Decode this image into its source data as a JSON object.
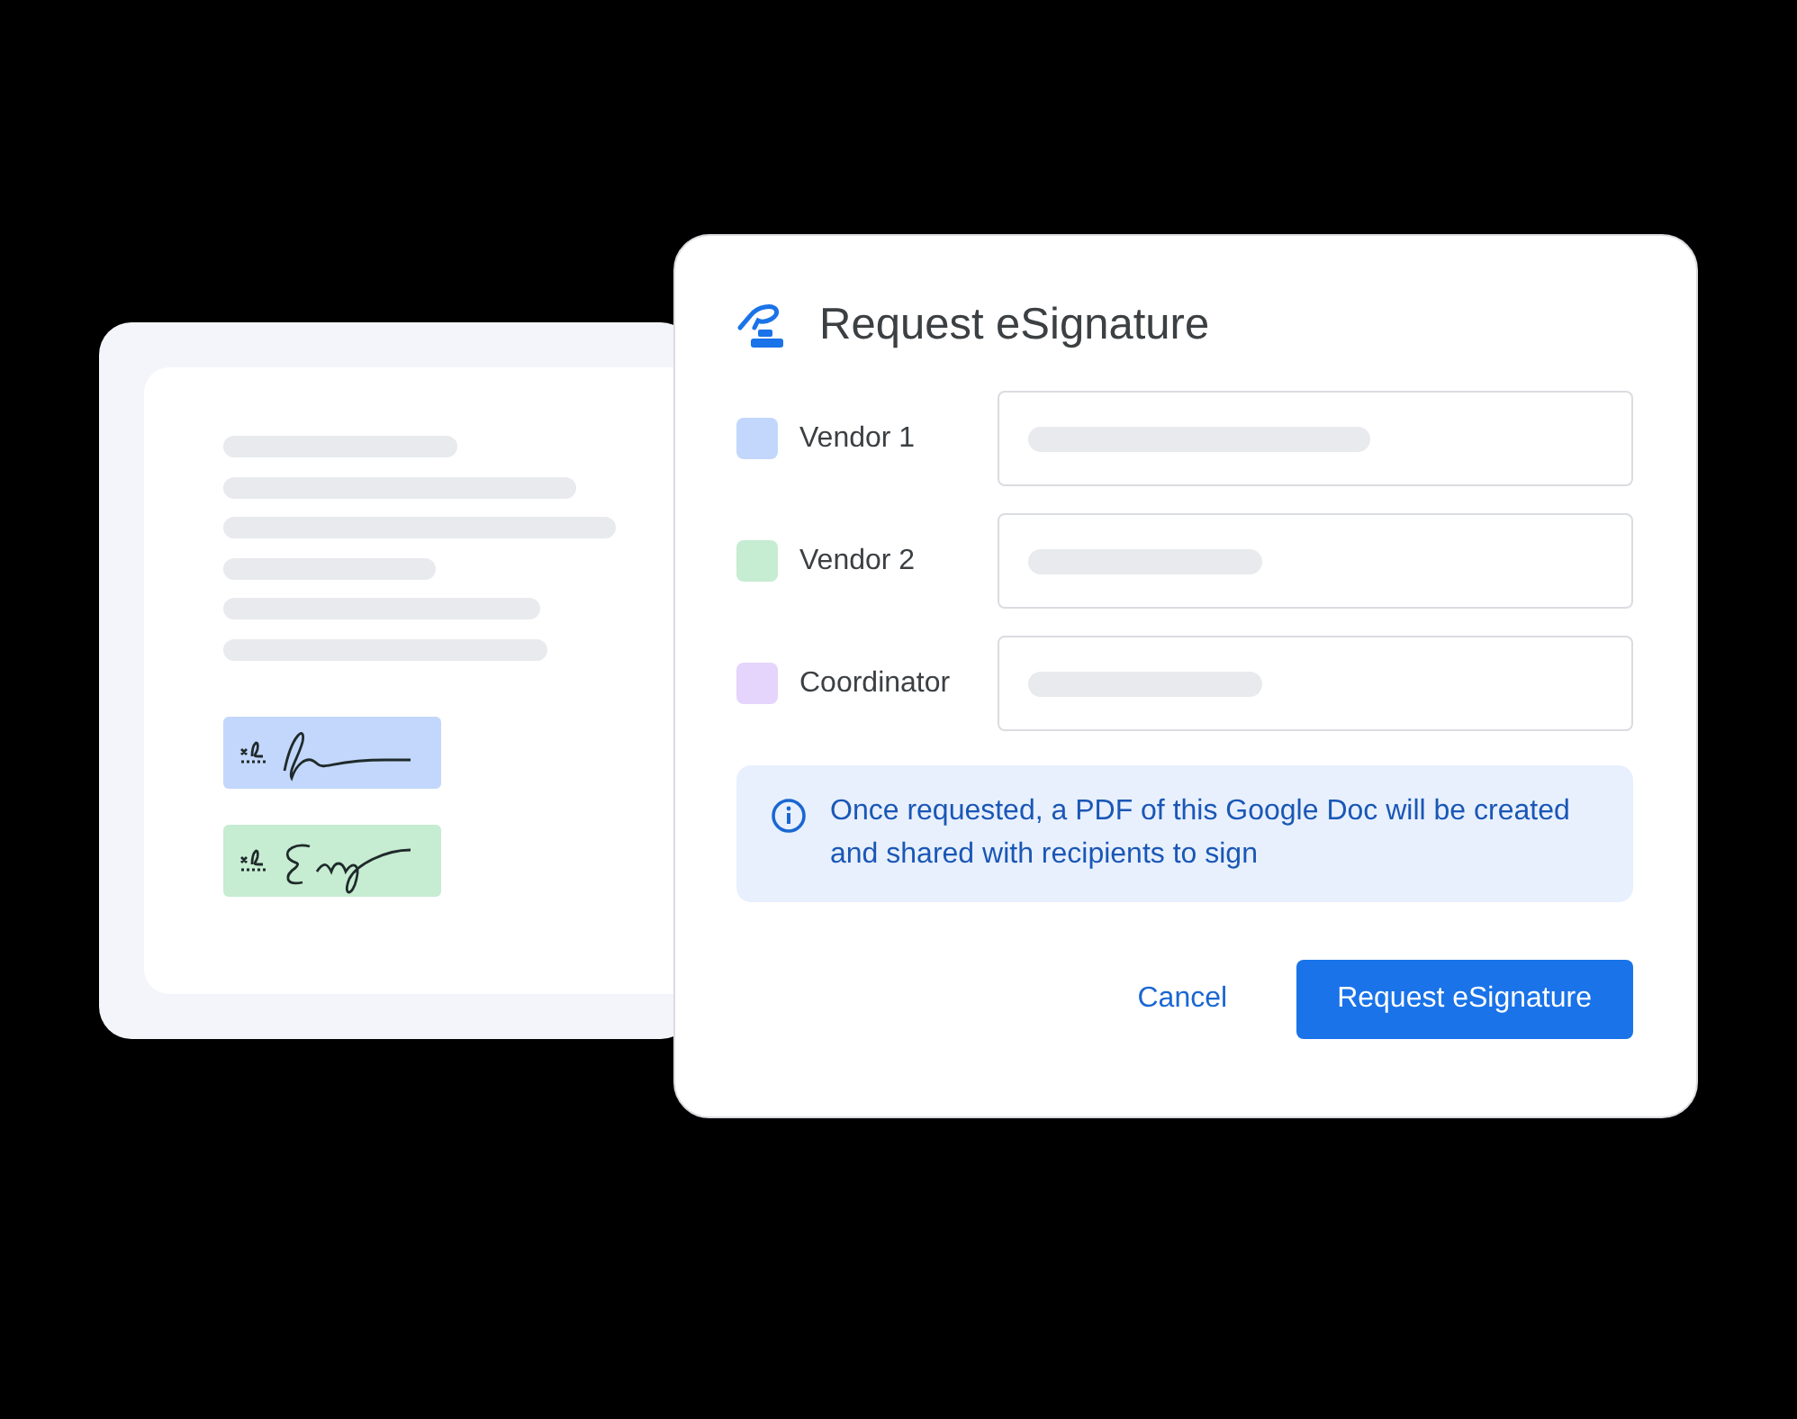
{
  "document": {
    "signatures": [
      {
        "color": "#c2d7fb"
      },
      {
        "color": "#c6ecd2"
      }
    ]
  },
  "dialog": {
    "title": "Request eSignature",
    "recipients": [
      {
        "label": "Vendor 1",
        "color": "#c2d7fb"
      },
      {
        "label": "Vendor 2",
        "color": "#c6ecd2"
      },
      {
        "label": "Coordinator",
        "color": "#e5d4fb"
      }
    ],
    "info": "Once requested, a PDF of this Google Doc will be created and shared with recipients to sign",
    "buttons": [
      {
        "label": "Cancel",
        "kind": "text"
      },
      {
        "label": "Request eSignature",
        "kind": "primary"
      }
    ]
  }
}
